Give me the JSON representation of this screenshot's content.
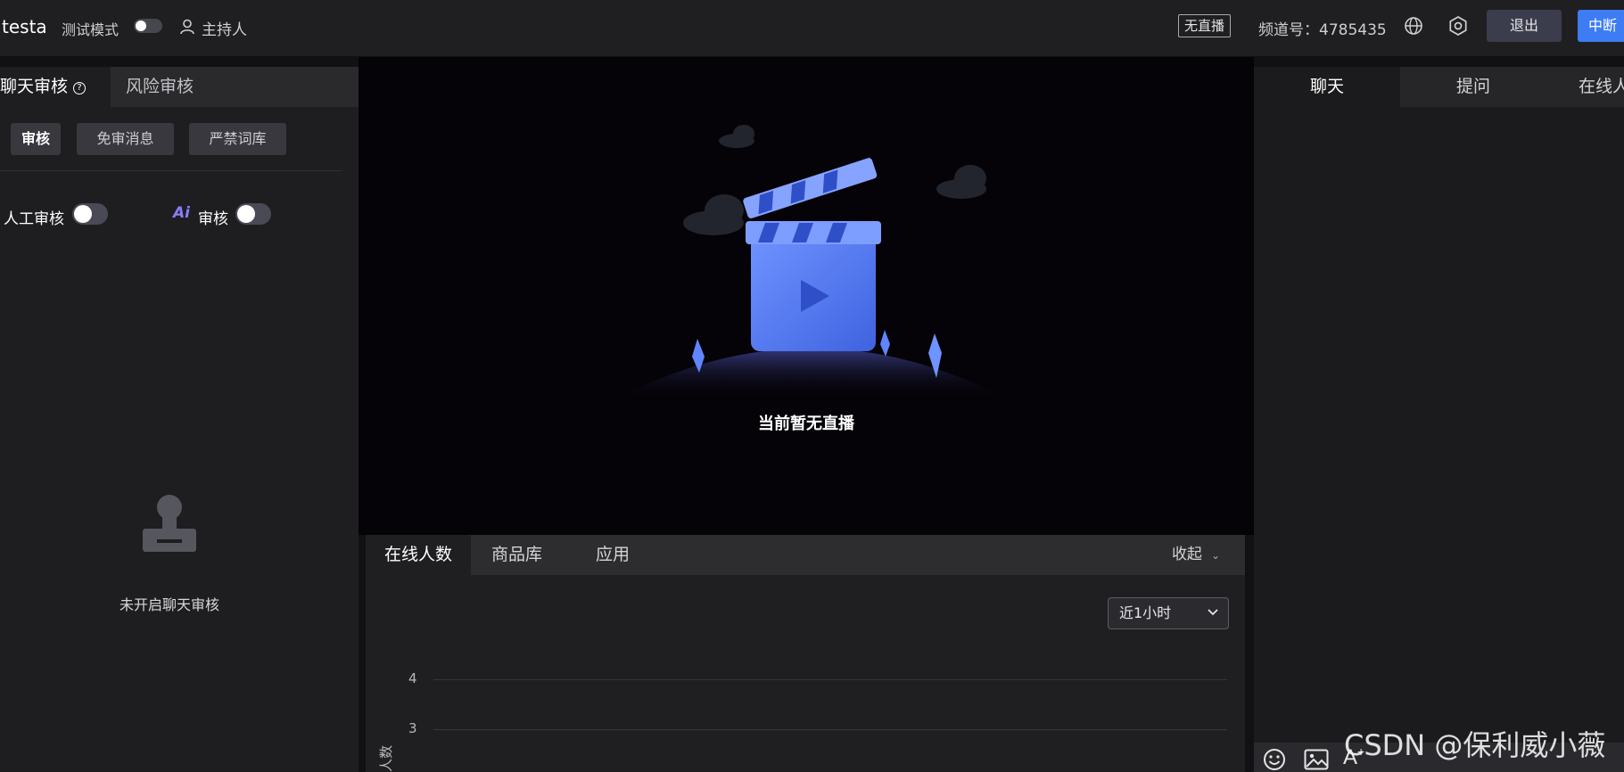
{
  "header": {
    "app_name": "testa",
    "test_mode_label": "测试模式",
    "test_mode_on": false,
    "host_label": "主持人",
    "live_status": "无直播",
    "channel_label": "频道号：4785435",
    "logout_label": "退出",
    "stop_label": "中断"
  },
  "left_panel": {
    "tabs": [
      "聊天审核",
      "风险审核"
    ],
    "active_tab": "聊天审核",
    "subtabs": [
      "审核",
      "免审消息",
      "严禁词库"
    ],
    "active_subtab": "审核",
    "manual_review_label": "人工审核",
    "manual_review_on": false,
    "ai_badge": "Ai",
    "ai_review_label": "审核",
    "ai_review_on": false,
    "empty_text": "未开启聊天审核"
  },
  "video": {
    "empty_text": "当前暂无直播"
  },
  "bottom_panel": {
    "tabs": [
      "在线人数",
      "商品库",
      "应用"
    ],
    "active_tab": "在线人数",
    "collapse_label": "收起",
    "range_value": "近1小时",
    "y_ticks": [
      "4",
      "3"
    ],
    "ylabel": "人数"
  },
  "right_panel": {
    "tabs": [
      "聊天",
      "提问",
      "在线人"
    ],
    "active_tab": "聊天",
    "font_icon_text": "A"
  },
  "watermark": "CSDN @保利威小薇",
  "colors": {
    "accent_blue": "#3d7cf3",
    "ai_purple": "#8a7cff"
  }
}
